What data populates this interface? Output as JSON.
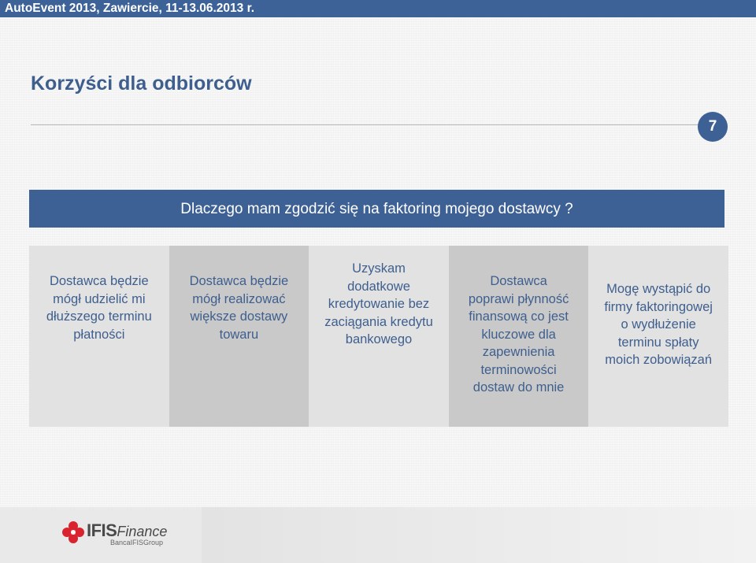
{
  "header": {
    "event_text": "AutoEvent 2013,  Zawiercie, 11-13.06.2013 r."
  },
  "slide": {
    "title": "Korzyści dla odbiorców",
    "page_number": "7",
    "question": "Dlaczego mam zgodzić się na faktoring mojego dostawcy ?"
  },
  "benefits": [
    {
      "lines": [
        "Dostawca będzie",
        "mógł udzielić mi",
        "dłuższego terminu",
        "płatności"
      ]
    },
    {
      "lines": [
        "Dostawca będzie",
        "mógł realizować",
        "większe dostawy",
        "towaru"
      ]
    },
    {
      "lines": [
        "Uzyskam",
        "dodatkowe",
        "kredytowanie bez",
        "zaciągania kredytu",
        "bankowego"
      ]
    },
    {
      "lines": [
        "Dostawca",
        "poprawi płynność",
        "finansową co jest",
        "kluczowe dla",
        "zapewnienia",
        "terminowości",
        "dostaw do mnie"
      ]
    },
    {
      "lines": [
        "Mogę wystąpić do",
        "firmy faktoringowej",
        "o wydłużenie",
        "terminu spłaty",
        "moich zobowiązań"
      ]
    }
  ],
  "footer": {
    "logo_icon": "ifis-flower-logo-icon",
    "brand_bold": "IFIS",
    "brand_rest": "Finance",
    "tagline": "BancaIFISGroup"
  },
  "colors": {
    "primary_blue": "#3e6195",
    "column_light": "#e2e2e2",
    "column_dark": "#c9c9c9",
    "logo_red": "#d9232e"
  }
}
